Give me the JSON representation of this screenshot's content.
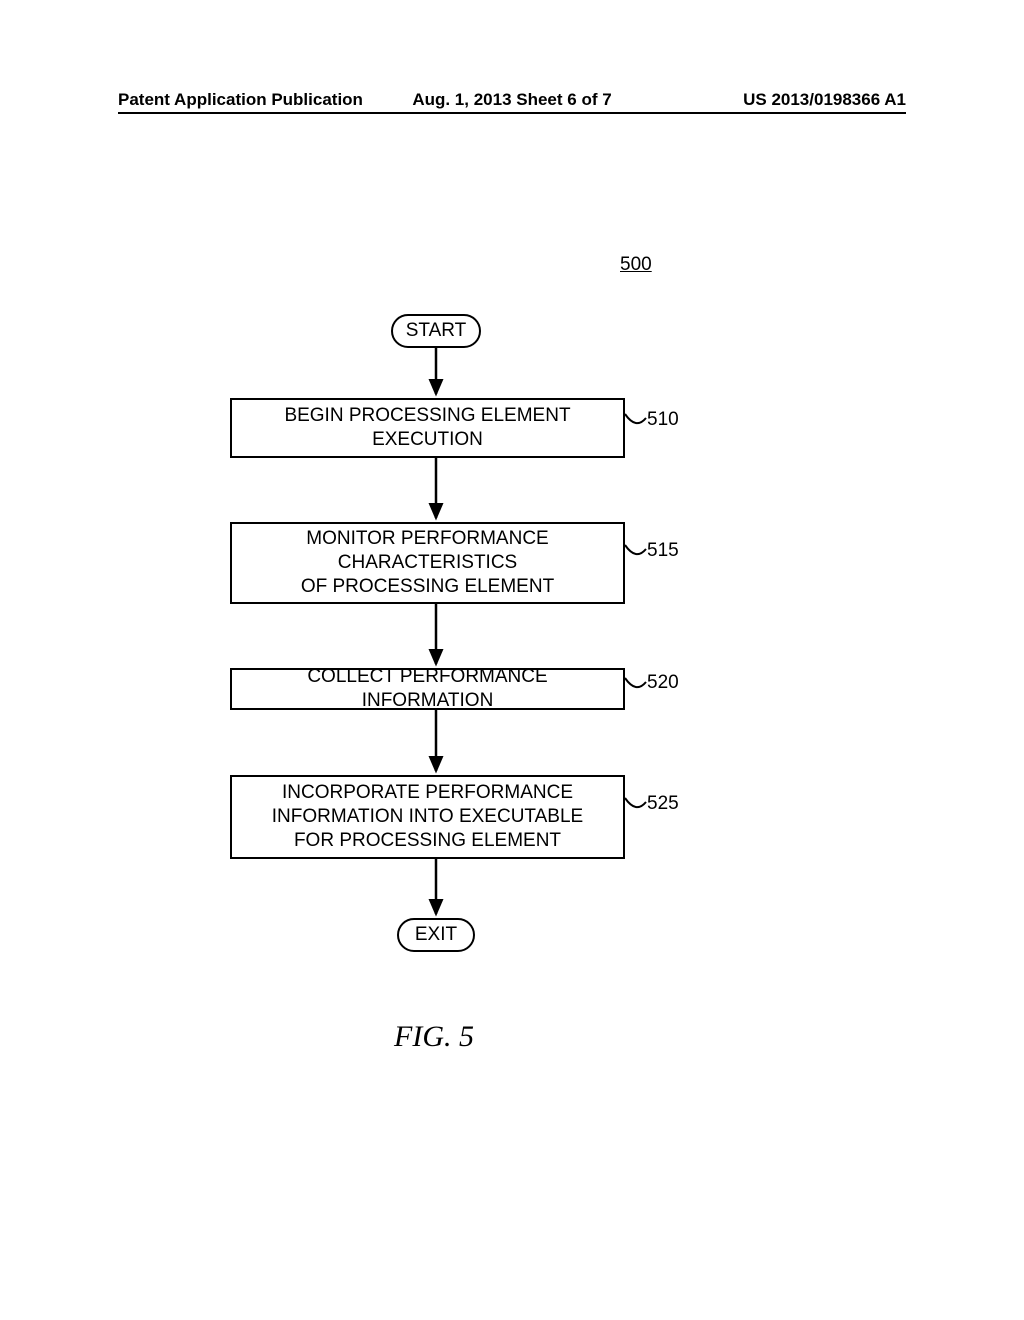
{
  "header": {
    "left": "Patent Application Publication",
    "center": "Aug. 1, 2013   Sheet 6 of 7",
    "right": "US 2013/0198366 A1"
  },
  "figure": {
    "ref": "500",
    "caption": "FIG. 5",
    "terminals": {
      "start": "START",
      "exit": "EXIT"
    },
    "steps": [
      {
        "ref": "510",
        "text": "BEGIN PROCESSING ELEMENT\nEXECUTION"
      },
      {
        "ref": "515",
        "text": "MONITOR PERFORMANCE\nCHARACTERISTICS\nOF PROCESSING ELEMENT"
      },
      {
        "ref": "520",
        "text": "COLLECT PERFORMANCE INFORMATION"
      },
      {
        "ref": "525",
        "text": "INCORPORATE PERFORMANCE\nINFORMATION INTO EXECUTABLE\nFOR PROCESSING ELEMENT"
      }
    ]
  }
}
